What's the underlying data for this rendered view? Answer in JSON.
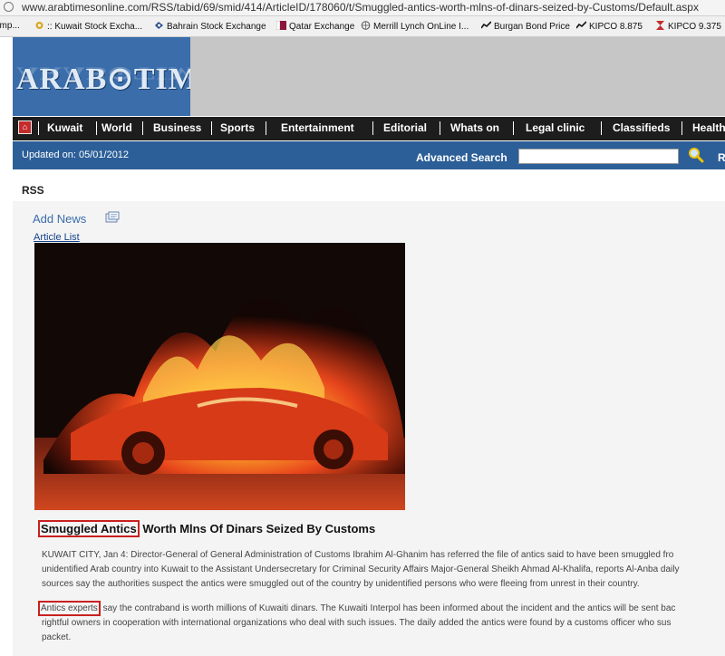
{
  "browser": {
    "url": "www.arabtimesonline.com/RSS/tabid/69/smid/414/ArticleID/178060/t/Smuggled-antics-worth-mlns-of-dinars-seized-by-Customs/Default.aspx",
    "favorites": [
      {
        "label": "omp...",
        "icon": "none"
      },
      {
        "label": ":: Kuwait Stock Excha...",
        "icon": "gear-icon"
      },
      {
        "label": "Bahrain Stock Exchange",
        "icon": "bahrain-icon"
      },
      {
        "label": "Qatar Exchange",
        "icon": "qatar-icon"
      },
      {
        "label": "Merrill Lynch OnLine I...",
        "icon": "globe-icon"
      },
      {
        "label": "Burgan Bond Price",
        "icon": "chart-icon"
      },
      {
        "label": "KIPCO 8.875",
        "icon": "chart-icon"
      },
      {
        "label": "KIPCO 9.375",
        "icon": "kipco-icon"
      }
    ]
  },
  "site": {
    "logo_text": "ARAB⊙TIMES",
    "nav": [
      "Kuwait",
      "World",
      "Business",
      "Sports",
      "Entertainment",
      "Editorial",
      "Whats on",
      "Legal clinic",
      "Classifieds",
      "Health"
    ],
    "updated": "Updated on: 05/01/2012",
    "advanced_search": "Advanced Search",
    "search_value": "",
    "search_more": "R"
  },
  "page": {
    "section": "RSS",
    "add_news": "Add News",
    "article_list": "Article List"
  },
  "article": {
    "headline_highlight": "Smuggled Antics",
    "headline_rest": " Worth Mlns Of Dinars Seized By Customs",
    "p1_lines": [
      "KUWAIT CITY, Jan 4: Director-General of General Administration of Customs Ibrahim Al-Ghanim has referred the file of antics said to have been smuggled fro",
      "unidentified Arab country into Kuwait to the Assistant Undersecretary for Criminal Security Affairs Major-General Sheikh Ahmad Al-Khalifa, reports Al-Anba daily",
      "sources say the authorities suspect the antics were smuggled out of the country by unidentified persons who were fleeing from unrest in their country."
    ],
    "p2_highlight": "Antics experts",
    "p2_line1_rest": " say the contraband is worth millions of Kuwaiti dinars. The Kuwaiti Interpol has been informed about the incident and the antics will be sent bac",
    "p2_lines": [
      "rightful owners in cooperation with international organizations who deal with such issues. The daily added the antics were found by a customs officer who sus",
      "packet."
    ]
  },
  "colors": {
    "brand_blue": "#3a6daa",
    "nav_black": "#1d1d1d",
    "updated_bar": "#2c5f98",
    "highlight_red": "#c9201f",
    "link_blue": "#3a6cad"
  }
}
